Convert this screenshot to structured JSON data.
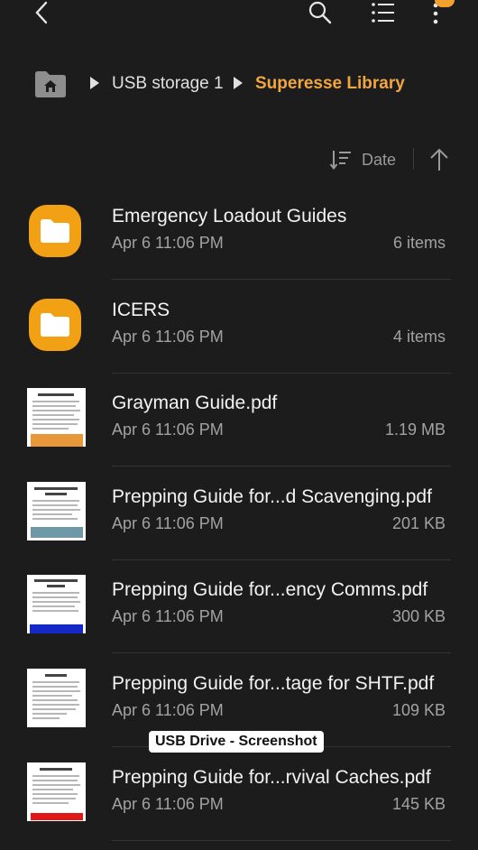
{
  "breadcrumb": {
    "items": [
      "USB storage 1",
      "Superesse Library"
    ]
  },
  "sort": {
    "label": "Date"
  },
  "files": [
    {
      "name": "Emergency Loadout Guides",
      "date": "Apr 6 11:06 PM",
      "meta": "6 items",
      "kind": "folder"
    },
    {
      "name": "ICERS",
      "date": "Apr 6 11:06 PM",
      "meta": "4 items",
      "kind": "folder"
    },
    {
      "name": "Grayman Guide.pdf",
      "date": "Apr 6 11:06 PM",
      "meta": "1.19 MB",
      "kind": "pdf",
      "accent": "#e8973a"
    },
    {
      "name": "Prepping Guide for...d Scavenging.pdf",
      "date": "Apr 6 11:06 PM",
      "meta": "201 KB",
      "kind": "pdf",
      "accent": "#6f98a6"
    },
    {
      "name": "Prepping Guide for...ency Comms.pdf",
      "date": "Apr 6 11:06 PM",
      "meta": "300 KB",
      "kind": "pdf",
      "accent": "#1428c8"
    },
    {
      "name": "Prepping Guide for...tage for SHTF.pdf",
      "date": "Apr 6 11:06 PM",
      "meta": "109 KB",
      "kind": "pdf",
      "accent": "#ffffff"
    },
    {
      "name": "Prepping Guide for...rvival Caches.pdf",
      "date": "Apr 6 11:06 PM",
      "meta": "145 KB",
      "kind": "pdf",
      "accent": "#e01818"
    }
  ],
  "watermark": {
    "text": "USB Drive - Screenshot"
  },
  "colors": {
    "background": "#1c1c1c",
    "accent": "#f2a640",
    "folder": "#f2a014"
  }
}
